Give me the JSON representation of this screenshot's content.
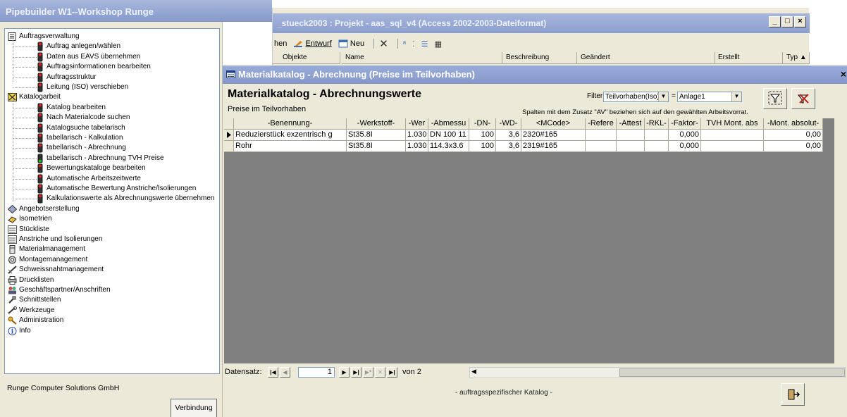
{
  "left_window": {
    "title": "Pipebuilder W1--Workshop Runge",
    "company": "Runge Computer Solutions GmbH",
    "connection_button": "Verbindung",
    "tree": [
      {
        "label": "Auftragsverwaltung",
        "icon": "folder-doc-icon",
        "level": 0
      },
      {
        "label": "Auftrag anlegen/wählen",
        "icon": "traffic-light-icon",
        "level": 1
      },
      {
        "label": "Daten aus EAVS übernehmen",
        "icon": "traffic-light-icon",
        "level": 1
      },
      {
        "label": "Auftragsinformationen bearbeiten",
        "icon": "traffic-light-icon",
        "level": 1
      },
      {
        "label": "Auftragsstruktur",
        "icon": "traffic-light-icon",
        "level": 1
      },
      {
        "label": "Leitung (ISO) verschieben",
        "icon": "traffic-light-icon",
        "level": 1
      },
      {
        "label": "Katalogarbeit",
        "icon": "catalog-icon",
        "level": 0
      },
      {
        "label": "Katalog bearbeiten",
        "icon": "traffic-light-icon",
        "level": 1
      },
      {
        "label": "Nach Materialcode suchen",
        "icon": "traffic-light-icon",
        "level": 1
      },
      {
        "label": "Katalogsuche tabelarisch",
        "icon": "traffic-light-icon",
        "level": 1
      },
      {
        "label": "tabellarisch - Kalkulation",
        "icon": "traffic-light-icon",
        "level": 1
      },
      {
        "label": "tabellarisch - Abrechnung",
        "icon": "traffic-light-icon",
        "level": 1
      },
      {
        "label": "tabellarisch - Abrechnung TVH Preise",
        "icon": "traffic-light-green-icon",
        "level": 1
      },
      {
        "label": "Bewertungskataloge bearbeiten",
        "icon": "traffic-light-icon",
        "level": 1
      },
      {
        "label": "Automatische Arbeitszeitwerte",
        "icon": "traffic-light-icon",
        "level": 1
      },
      {
        "label": "Automatische Bewertung Anstriche/Isolierungen",
        "icon": "traffic-light-icon",
        "level": 1
      },
      {
        "label": "Kalkulationswerte als Abrechnungswerte übernehmen",
        "icon": "traffic-light-icon",
        "level": 1
      },
      {
        "label": "Angebotserstellung",
        "icon": "diamond-icon",
        "level": 0
      },
      {
        "label": "Isometrien",
        "icon": "isometric-icon",
        "level": 0
      },
      {
        "label": "Stückliste",
        "icon": "list-icon",
        "level": 0
      },
      {
        "label": "Anstriche und Isolierungen",
        "icon": "list-icon",
        "level": 0
      },
      {
        "label": "Materialmanagement",
        "icon": "pipe-icon",
        "level": 0
      },
      {
        "label": "Montagemanagement",
        "icon": "gear-icon",
        "level": 0
      },
      {
        "label": "Schweissnahtmanagement",
        "icon": "weld-icon",
        "level": 0
      },
      {
        "label": "Drucklisten",
        "icon": "printer-icon",
        "level": 0
      },
      {
        "label": "Geschäftspartner/Anschriften",
        "icon": "people-icon",
        "level": 0
      },
      {
        "label": "Schnittstellen",
        "icon": "plug-icon",
        "level": 0
      },
      {
        "label": "Werkzeuge",
        "icon": "tools-icon",
        "level": 0
      },
      {
        "label": "Administration",
        "icon": "key-icon",
        "level": 0
      },
      {
        "label": "Info",
        "icon": "info-icon",
        "level": 0
      }
    ]
  },
  "access_window": {
    "title": "_stueck2003 : Projekt - aas_sql_v4 (Access 2002-2003-Dateiformat)",
    "toolbar": {
      "open_partial": "hen",
      "design": "Entwurf",
      "new": "Neu"
    },
    "columns": [
      "Objekte",
      "Name",
      "Beschreibung",
      "Geändert",
      "Erstellt",
      "Typ ▲"
    ]
  },
  "form": {
    "title": "Materialkatalog - Abrechnung (Preise im Teilvorhaben)",
    "heading": "Materialkatalog - Abrechnungswerte",
    "subheading": "Preise im Teilvorhaben",
    "filter_label": "Filter",
    "filter_value": "Teilvorhaben(Iso)",
    "equals": "=",
    "filter_target": "Anlage1",
    "hint": "Spalten mit dem Zusatz \"AV\" beziehen sich auf den gewählten Arbeitsvorrat.",
    "close_glyph": "×",
    "columns": [
      "-Benennung-",
      "-Werkstoff-",
      "-Wer",
      "-Abmessu",
      "-DN-",
      "-WD-",
      "<MCode>",
      "-Refere",
      "-Attest",
      "-RKL-",
      "-Faktor-",
      "TVH Mont. abs",
      "-Mont. absolut-"
    ],
    "rows": [
      [
        "Reduzierstück exzentrisch g",
        "St35.8I",
        "1.030",
        "DN 100 11",
        "100",
        "3,6",
        "2320#165",
        "",
        "",
        "",
        "0,000",
        "",
        "0,00"
      ],
      [
        "Rohr",
        "St35.8I",
        "1.030",
        "114.3x3.6",
        "100",
        "3,6",
        "2319#165",
        "",
        "",
        "",
        "0,000",
        "",
        "0,00"
      ]
    ],
    "nav": {
      "label": "Datensatz:",
      "current": "1",
      "of": "von 2"
    },
    "footer": "- auftragsspezifischer Katalog -"
  }
}
